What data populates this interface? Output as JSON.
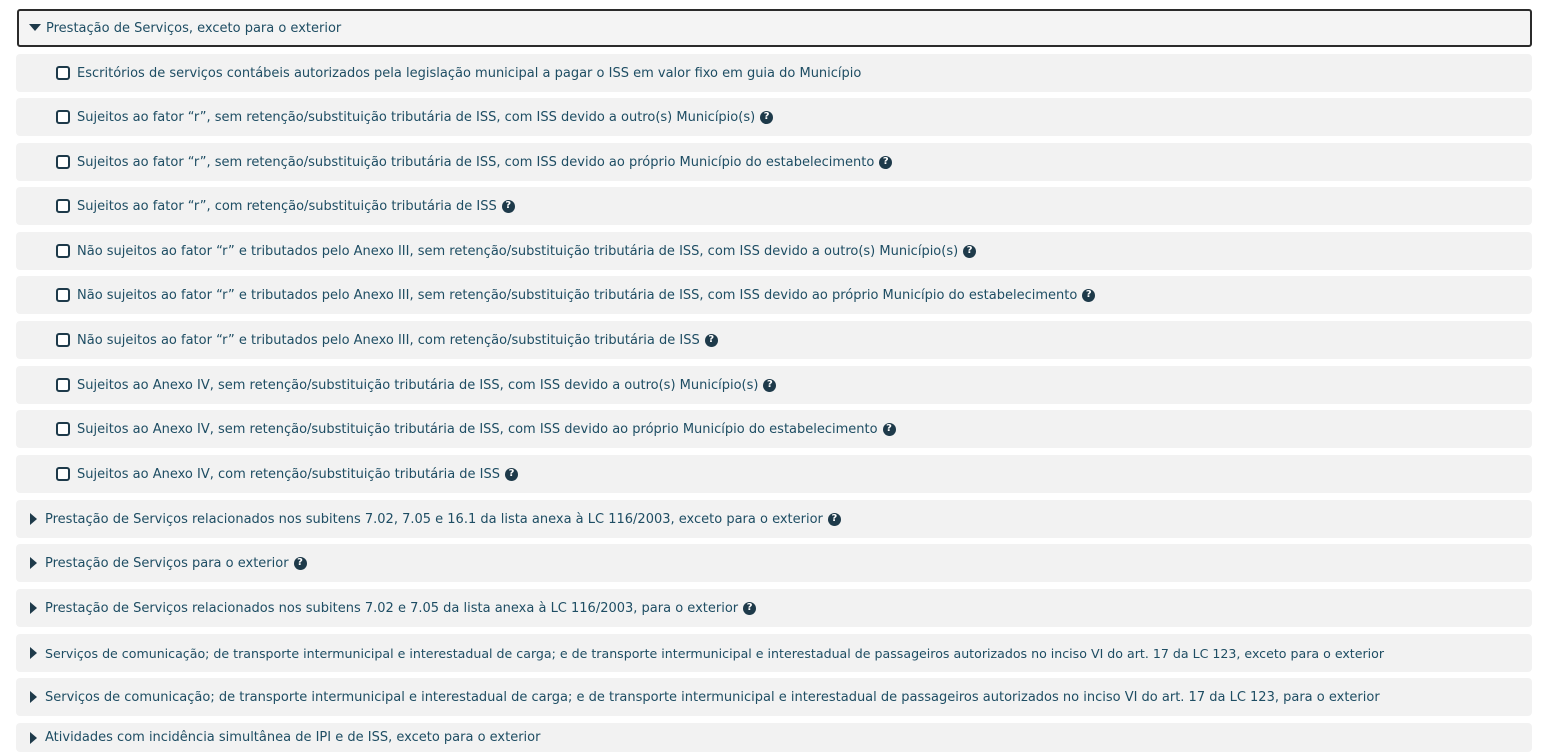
{
  "groups": [
    {
      "label": "Prestação de Serviços, exceto para o exterior",
      "expanded": true,
      "icon": "caret-down-icon",
      "children": [
        {
          "label": "Escritórios de serviços contábeis autorizados pela legislação municipal a pagar o ISS em valor fixo em guia do Município",
          "help": false
        },
        {
          "label": "Sujeitos ao fator “r”, sem retenção/substituição tributária de ISS, com ISS devido a outro(s) Município(s)",
          "help": true
        },
        {
          "label": "Sujeitos ao fator “r”, sem retenção/substituição tributária de ISS, com ISS devido ao próprio Município do estabelecimento",
          "help": true
        },
        {
          "label": "Sujeitos ao fator “r”, com retenção/substituição tributária de ISS",
          "help": true
        },
        {
          "label": "Não sujeitos ao fator “r” e tributados pelo Anexo III, sem retenção/substituição tributária de ISS, com ISS devido a outro(s) Município(s)",
          "help": true
        },
        {
          "label": "Não sujeitos ao fator “r” e tributados pelo Anexo III, sem retenção/substituição tributária de ISS, com ISS devido ao próprio Município do estabelecimento",
          "help": true
        },
        {
          "label": "Não sujeitos ao fator “r” e tributados pelo Anexo III, com retenção/substituição tributária de ISS",
          "help": true
        },
        {
          "label": "Sujeitos ao Anexo IV, sem retenção/substituição tributária de ISS, com ISS devido a outro(s) Município(s)",
          "help": true
        },
        {
          "label": "Sujeitos ao Anexo IV, sem retenção/substituição tributária de ISS, com ISS devido ao próprio Município do estabelecimento",
          "help": true
        },
        {
          "label": "Sujeitos ao Anexo IV, com retenção/substituição tributária de ISS",
          "help": true
        }
      ]
    },
    {
      "label": "Prestação de Serviços relacionados nos subitens 7.02, 7.05 e 16.1 da lista anexa à LC 116/2003, exceto para o exterior",
      "expanded": false,
      "help": true
    },
    {
      "label": "Prestação de Serviços para o exterior",
      "expanded": false,
      "help": true
    },
    {
      "label": "Prestação de Serviços relacionados nos subitens 7.02 e 7.05 da lista anexa à LC 116/2003, para o exterior",
      "expanded": false,
      "help": true
    },
    {
      "label": "Serviços de comunicação; de transporte intermunicipal e interestadual de carga; e de transporte intermunicipal e interestadual de passageiros autorizados no inciso VI do art. 17 da LC 123, exceto para o exterior",
      "expanded": false,
      "help": false
    },
    {
      "label": "Serviços de comunicação; de transporte intermunicipal e interestadual de carga; e de transporte intermunicipal e interestadual de passageiros autorizados no inciso VI do art. 17 da LC 123, para o exterior",
      "expanded": false,
      "help": false
    },
    {
      "label": "Atividades com incidência simultânea de IPI e de ISS, exceto para o exterior",
      "expanded": false,
      "help": false
    }
  ],
  "help_glyph": "?",
  "colors": {
    "text": "#1e4d63",
    "icon": "#1e3a4a",
    "row_bg": "#f2f2f2",
    "border": "#2b2b2b"
  }
}
